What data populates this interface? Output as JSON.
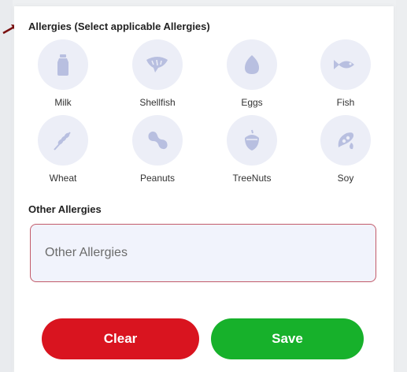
{
  "allergies_section": {
    "title": "Allergies (Select applicable Allergies)",
    "items": [
      {
        "label": "Milk",
        "icon": "milk-bottle-icon"
      },
      {
        "label": "Shellfish",
        "icon": "shrimp-icon"
      },
      {
        "label": "Eggs",
        "icon": "egg-icon"
      },
      {
        "label": "Fish",
        "icon": "fish-icon"
      },
      {
        "label": "Wheat",
        "icon": "wheat-icon"
      },
      {
        "label": "Peanuts",
        "icon": "peanut-icon"
      },
      {
        "label": "TreeNuts",
        "icon": "tree-nut-icon"
      },
      {
        "label": "Soy",
        "icon": "soy-icon"
      }
    ]
  },
  "other_allergies": {
    "title": "Other Allergies",
    "placeholder": "Other Allergies",
    "value": ""
  },
  "buttons": {
    "clear_label": "Clear",
    "save_label": "Save"
  },
  "colors": {
    "icon_circle": "#eceef7",
    "icon_fill": "#b8bfe0",
    "input_border": "#c25a6a",
    "input_background": "#f1f3fc",
    "clear_button": "#d9141f",
    "save_button": "#17b12b"
  }
}
